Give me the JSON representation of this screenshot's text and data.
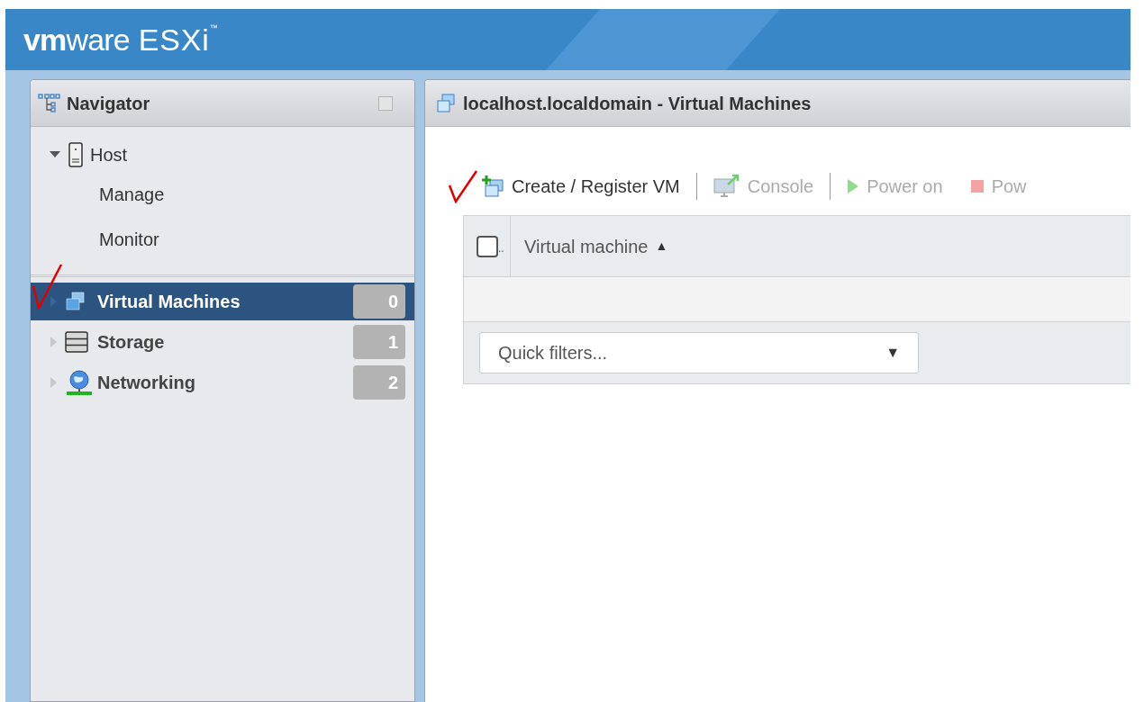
{
  "logo": {
    "brand": "**vm**ware",
    "product": "ESXi",
    "mark": "™"
  },
  "navigator": {
    "title": "Navigator",
    "host": {
      "label": "Host",
      "expanded": true,
      "children": [
        {
          "label": "Manage"
        },
        {
          "label": "Monitor"
        }
      ]
    },
    "items": [
      {
        "label": "Virtual Machines",
        "kind": "vms",
        "count": "0",
        "selected": true,
        "expanded": false
      },
      {
        "label": "Storage",
        "kind": "storage",
        "count": "1",
        "selected": false,
        "expanded": false
      },
      {
        "label": "Networking",
        "kind": "network",
        "count": "2",
        "selected": false,
        "expanded": false
      }
    ]
  },
  "main": {
    "title": "localhost.localdomain - Virtual Machines",
    "toolbar": [
      {
        "label": "Create / Register VM",
        "kind": "create",
        "disabled": false
      },
      {
        "label": "Console",
        "kind": "console",
        "disabled": true
      },
      {
        "label": "Power on",
        "kind": "power_on",
        "disabled": true
      },
      {
        "label": "Pow",
        "kind": "power_off",
        "disabled": true
      }
    ],
    "table": {
      "select_all": {
        "checked": false,
        "label": ".."
      },
      "columns": [
        {
          "label": "Virtual machine",
          "sort": "▲"
        }
      ]
    },
    "quick_filters": {
      "placeholder": "Quick filters...",
      "arrow": "▼"
    }
  }
}
